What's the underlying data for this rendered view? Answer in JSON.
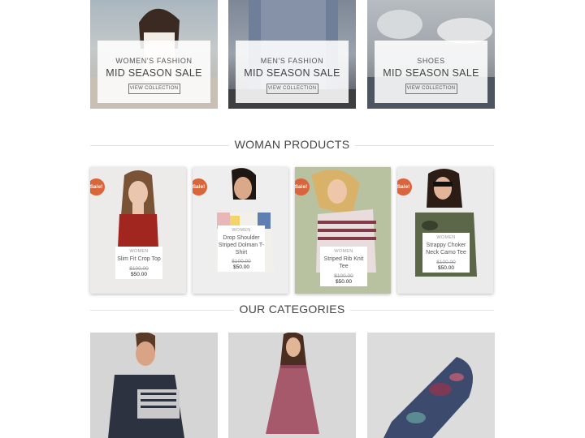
{
  "banners": [
    {
      "subtitle": "WOMEN'S FASHION",
      "title": "MID SEASON SALE",
      "button": "VIEW COLLECTION"
    },
    {
      "subtitle": "MEN'S FASHION",
      "title": "MID SEASON SALE",
      "button": "VIEW COLLECTION"
    },
    {
      "subtitle": "SHOES",
      "title": "MID SEASON SALE",
      "button": "VIEW COLLECTION"
    }
  ],
  "sections": {
    "products_title": "WOMAN PRODUCTS",
    "categories_title": "OUR CATEGORIES"
  },
  "products": [
    {
      "badge": "Sale!",
      "category": "WOMEN",
      "name": "Slim Fit Crop Top",
      "old_price": "$100.00",
      "price": "$50.00"
    },
    {
      "badge": "Sale!",
      "category": "WOMEN",
      "name": "Drop Shoulder Striped Dolman T-Shirt",
      "old_price": "$100.00",
      "price": "$50.00"
    },
    {
      "badge": "Sale!",
      "category": "WOMEN",
      "name": "Striped Rib Knit Tee",
      "old_price": "$100.00",
      "price": "$50.00"
    },
    {
      "badge": "Sale!",
      "category": "WOMEN",
      "name": "Strappy Choker Neck Camo Tee",
      "old_price": "$100.00",
      "price": "$50.00"
    }
  ],
  "colors": {
    "sale_badge": "#d9653c",
    "heading_text": "#444444",
    "divider": "#e2e2e2"
  }
}
